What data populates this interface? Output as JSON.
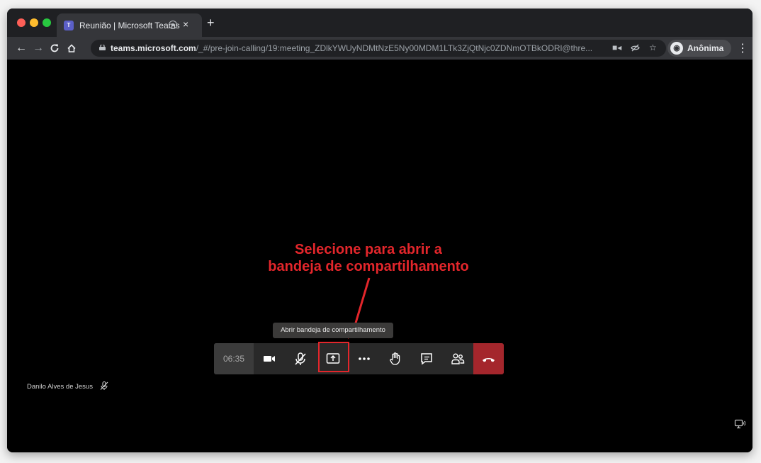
{
  "browser": {
    "tab_title": "Reunião | Microsoft Teams",
    "tab_close": "×",
    "new_tab": "+",
    "url_host": "teams.microsoft.com",
    "url_path": "/_#/pre-join-calling/19:meeting_ZDlkYWUyNDMtNzE5Ny00MDM1LTk3ZjQtNjc0ZDNmOTBkODRl@thre...",
    "profile_label": "Anônima",
    "icons": [
      "back-icon",
      "forward-icon",
      "reload-icon",
      "home-icon",
      "lock-icon",
      "camera-icon",
      "eye-off-icon",
      "star-icon",
      "incognito-icon",
      "menu-icon"
    ]
  },
  "meeting": {
    "annotation": "Selecione para abrir a\nbandeja de compartilhamento",
    "tooltip": "Abrir bandeja de compartilhamento",
    "timer": "06:35",
    "participant_name": "Danilo Alves de Jesus",
    "controls": [
      "camera-icon",
      "mic-off-icon",
      "share-icon",
      "more-icon",
      "raise-hand-icon",
      "chat-icon",
      "participants-icon",
      "hang-up-icon"
    ]
  },
  "colors": {
    "annotation_red": "#e3262b",
    "hangup_red": "#a4262c",
    "callbar_bg": "#292929",
    "teams_purple": "#5b5fc7"
  }
}
